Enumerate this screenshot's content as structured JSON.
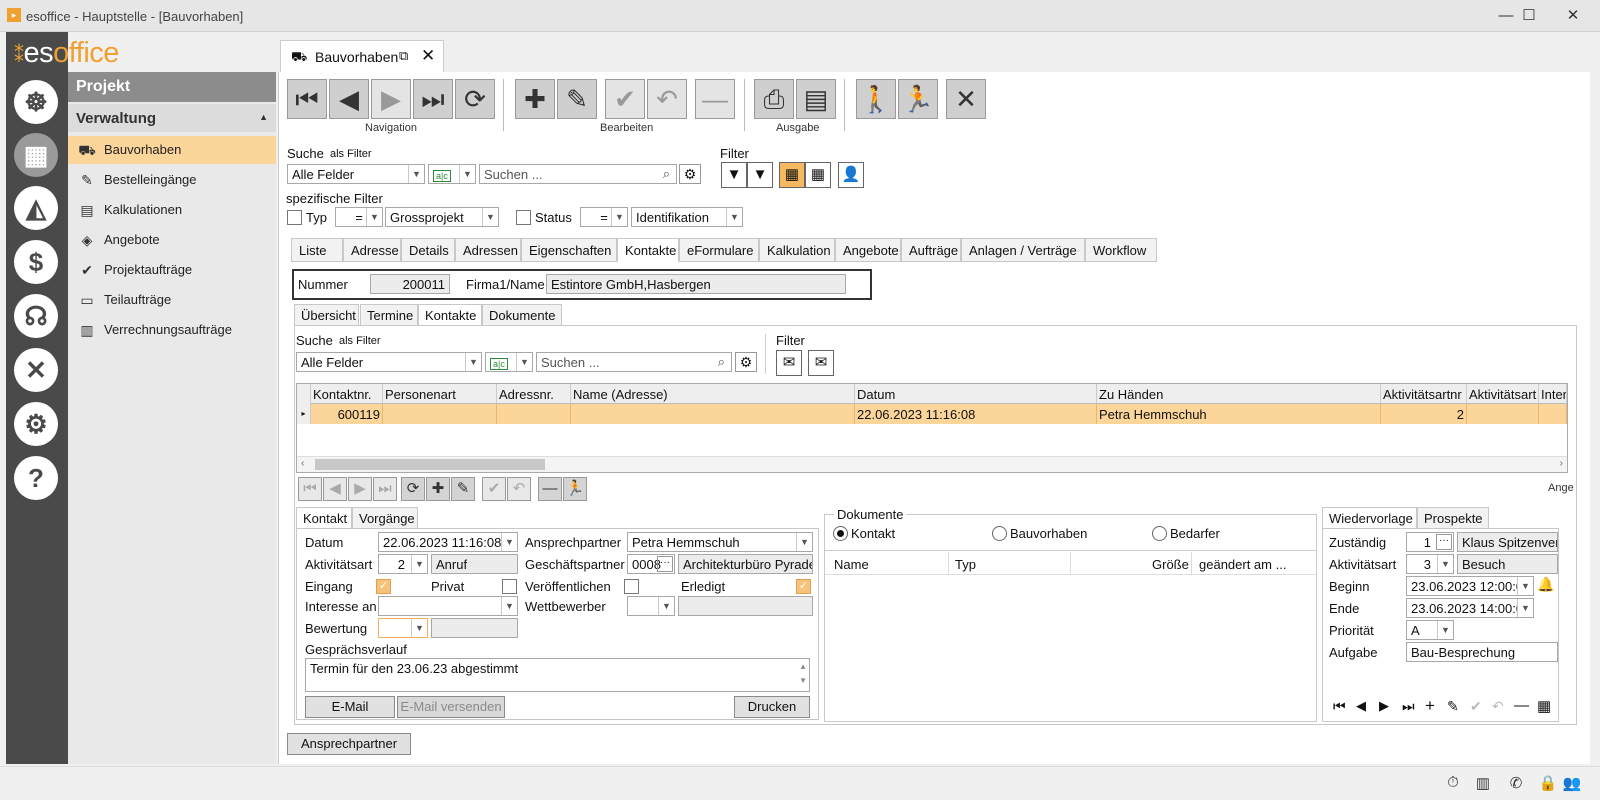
{
  "window": {
    "title": "esoffice - Hauptstelle - [Bauvorhaben]",
    "minimize": "—",
    "maximize": "☐",
    "close": "✕"
  },
  "brand": {
    "logo_prefix": "es",
    "logo_suffix": "office",
    "accent": "#f0a030"
  },
  "nav_icons": [
    {
      "icon": "helm-icon",
      "glyph": "☸"
    },
    {
      "icon": "projects-icon",
      "glyph": "▦"
    },
    {
      "icon": "alarm-icon",
      "glyph": "🚨"
    },
    {
      "icon": "finance-icon",
      "glyph": "$"
    },
    {
      "icon": "support-icon",
      "glyph": "☎"
    },
    {
      "icon": "tools-icon",
      "glyph": "✖"
    },
    {
      "icon": "settings-icon",
      "glyph": "⚙"
    },
    {
      "icon": "help-icon",
      "glyph": "?"
    }
  ],
  "menu": {
    "header": "Projekt",
    "section": "Verwaltung",
    "items": [
      {
        "label": "Bauvorhaben",
        "icon": "construction-icon",
        "glyph": "⛟"
      },
      {
        "label": "Bestelleingänge",
        "icon": "order-icon",
        "glyph": "✎"
      },
      {
        "label": "Kalkulationen",
        "icon": "calculation-icon",
        "glyph": "▤"
      },
      {
        "label": "Angebote",
        "icon": "offer-icon",
        "glyph": "◈"
      },
      {
        "label": "Projektaufträge",
        "icon": "check-icon",
        "glyph": "✔"
      },
      {
        "label": "Teilaufträge",
        "icon": "partial-order-icon",
        "glyph": "▭"
      },
      {
        "label": "Verrechnungsaufträge",
        "icon": "billing-icon",
        "glyph": "▥"
      }
    ]
  },
  "document_tab": {
    "label": "Bauvorhaben"
  },
  "toolbar": {
    "navigation_label": "Navigation",
    "edit_label": "Bearbeiten",
    "output_label": "Ausgabe"
  },
  "search": {
    "label": "Suche",
    "as_filter": "als Filter",
    "field": "Alle Felder",
    "placeholder": "Suchen ...",
    "filter_label": "Filter"
  },
  "specific_filter": {
    "label": "spezifische Filter",
    "typ_label": "Typ",
    "typ_op": "=",
    "typ_value": "Grossprojekt",
    "status_label": "Status",
    "status_op": "=",
    "status_value": "Identifikation"
  },
  "main_tabs": [
    "Liste",
    "Adresse",
    "Details",
    "Adressen",
    "Eigenschaften",
    "Kontakte",
    "eFormulare",
    "Kalkulation",
    "Angebote",
    "Aufträge",
    "Anlagen / Verträge",
    "Workflow"
  ],
  "record": {
    "nummer_label": "Nummer",
    "nummer": "200011",
    "firma_label": "Firma1/Name",
    "firma": "Estintore GmbH,Hasbergen"
  },
  "sub_tabs": [
    "Übersicht",
    "Termine",
    "Kontakte",
    "Dokumente"
  ],
  "inner_search": {
    "label": "Suche",
    "as_filter": "als Filter",
    "field": "Alle Felder",
    "placeholder": "Suchen ...",
    "filter_label": "Filter"
  },
  "grid": {
    "columns": [
      "Kontaktnr.",
      "Personenart",
      "Adressnr.",
      "Name (Adresse)",
      "Datum",
      "Zu Händen",
      "Aktivitätsartnr",
      "Aktivitätsart",
      "Inter"
    ],
    "rows": [
      [
        "600119",
        "",
        "",
        "",
        "22.06.2023 11:16:08",
        "Petra Hemmschuh",
        "2",
        "",
        ""
      ]
    ],
    "overflow_label": "Ange"
  },
  "contact_tabs": [
    "Kontakt",
    "Vorgänge"
  ],
  "contact": {
    "datum_label": "Datum",
    "datum": "22.06.2023 11:16:08",
    "aktivitaetsart_label": "Aktivitätsart",
    "aktivitaetsart_nr": "2",
    "aktivitaetsart": "Anruf",
    "eingang_label": "Eingang",
    "privat_label": "Privat",
    "interesse_label": "Interesse an",
    "bewertung_label": "Bewertung",
    "ansprechpartner_label": "Ansprechpartner",
    "ansprechpartner": "Petra Hemmschuh",
    "geschaeftspartner_label": "Geschäftspartner",
    "geschaeftspartner_nr": "0008",
    "geschaeftspartner": "Architekturbüro Pyrade",
    "veroeffentlichen_label": "Veröffentlichen",
    "erledigt_label": "Erledigt",
    "wettbewerber_label": "Wettbewerber",
    "verlauf_label": "Gesprächsverlauf",
    "verlauf": "Termin für den 23.06.23 abgestimmt",
    "email_button": "E-Mail",
    "email_send_button": "E-Mail versenden",
    "print_button": "Drucken"
  },
  "documents": {
    "label": "Dokumente",
    "options": [
      "Kontakt",
      "Bauvorhaben",
      "Bedarfer"
    ],
    "columns": [
      "Name",
      "Typ",
      "Größe",
      "geändert am ..."
    ]
  },
  "followup_tabs": [
    "Wiedervorlage",
    "Prospekte"
  ],
  "followup": {
    "zustaendig_label": "Zuständig",
    "zustaendig_nr": "1",
    "zustaendig": "Klaus Spitzenver",
    "aktivitaetsart_label": "Aktivitätsart",
    "aktivitaetsart_nr": "3",
    "aktivitaetsart": "Besuch",
    "beginn_label": "Beginn",
    "beginn": "23.06.2023 12:00:0",
    "ende_label": "Ende",
    "ende": "23.06.2023 14:00:0",
    "prioritaet_label": "Priorität",
    "prioritaet": "A",
    "aufgabe_label": "Aufgabe",
    "aufgabe": "Bau-Besprechung"
  },
  "bottom_button": "Ansprechpartner"
}
